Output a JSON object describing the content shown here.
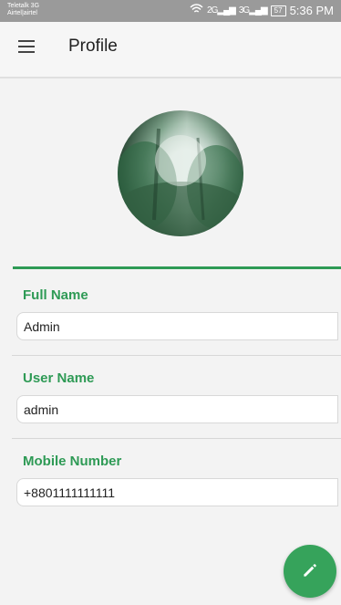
{
  "statusbar": {
    "carrier_line1": "Teletalk 3G",
    "carrier_line2": "Airtel|airtel",
    "network1": "2G",
    "network2": "3G",
    "battery": "57",
    "time": "5:36 PM"
  },
  "appbar": {
    "title": "Profile",
    "menu_icon": "hamburger-menu-icon"
  },
  "avatar": {
    "icon": "forest-profile-image"
  },
  "profile": {
    "full_name_label": "Full Name",
    "full_name_value": "Admin",
    "user_name_label": "User Name",
    "user_name_value": "admin",
    "mobile_label": "Mobile Number",
    "mobile_value": "+8801111111111"
  },
  "fab": {
    "icon": "edit-pencil-icon",
    "color": "#36a35b"
  },
  "colors": {
    "accent": "#2e9a55",
    "status_bar": "#9a9a9a"
  }
}
